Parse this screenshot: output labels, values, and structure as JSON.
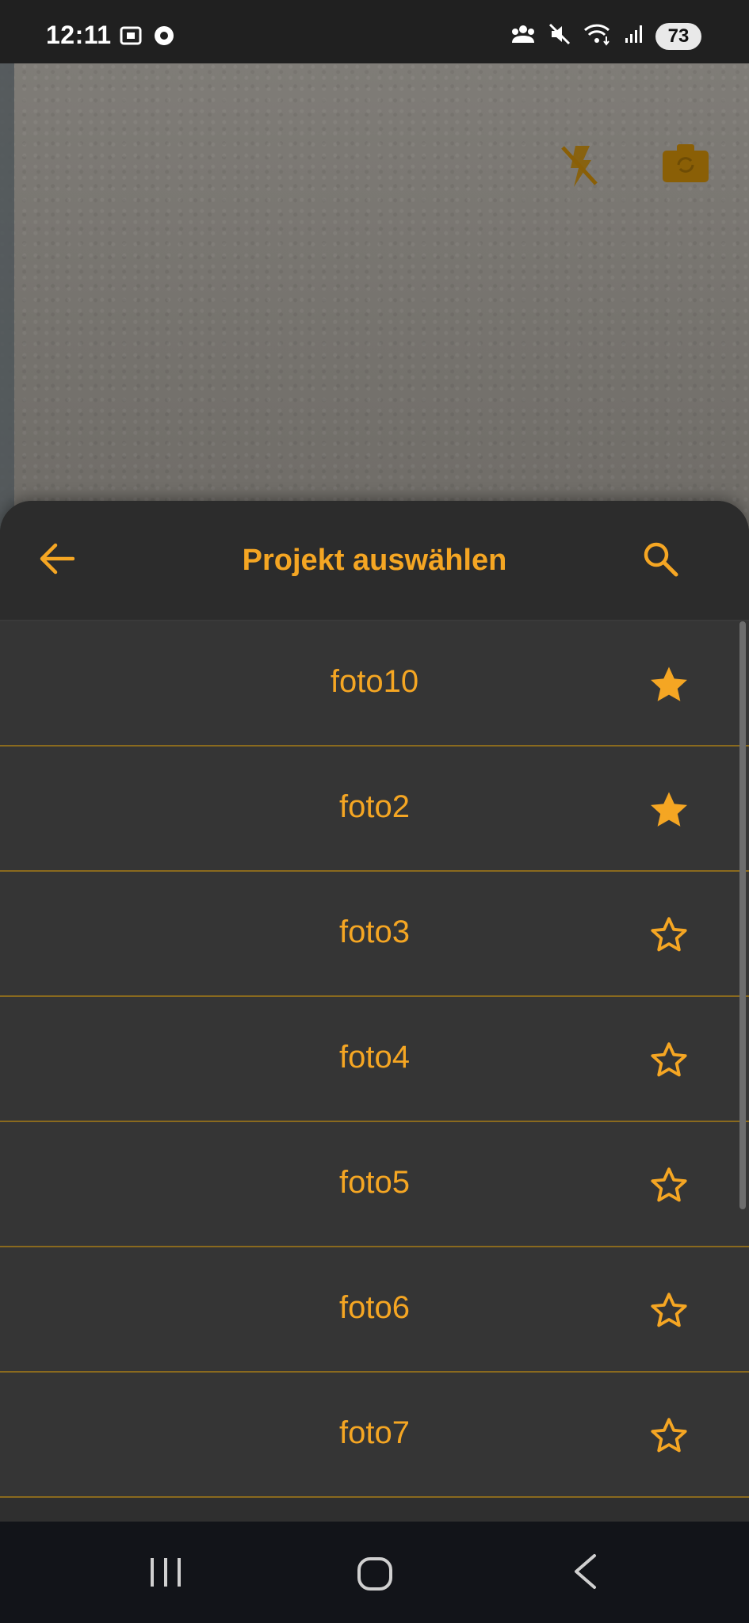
{
  "status_bar": {
    "time": "12:11",
    "battery": "73"
  },
  "sheet": {
    "title": "Projekt auswählen"
  },
  "projects": [
    {
      "name": "foto10",
      "favorite": true
    },
    {
      "name": "foto2",
      "favorite": true
    },
    {
      "name": "foto3",
      "favorite": false
    },
    {
      "name": "foto4",
      "favorite": false
    },
    {
      "name": "foto5",
      "favorite": false
    },
    {
      "name": "foto6",
      "favorite": false
    },
    {
      "name": "foto7",
      "favorite": false
    }
  ],
  "icons": {
    "back": "arrow-left-icon",
    "search": "search-icon",
    "star_filled": "star-filled-icon",
    "star_outline": "star-outline-icon",
    "flash": "flash-off-icon",
    "switch_camera": "switch-camera-icon"
  },
  "colors": {
    "accent": "#f5a623",
    "sheet_bg": "#2f2f2f",
    "row_bg": "#353535",
    "divider": "#8a6a1e"
  }
}
